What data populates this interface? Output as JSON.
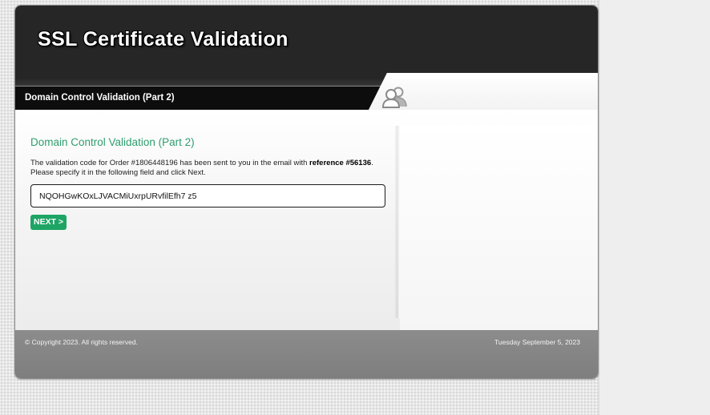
{
  "header": {
    "title": "SSL Certificate Validation"
  },
  "subbar": {
    "title": "Domain Control Validation (Part 2)"
  },
  "main": {
    "heading": "Domain Control Validation (Part 2)",
    "text_prefix": "The validation code for Order #1806448196 has been sent to you in the email with ",
    "text_bold": "reference #56136",
    "text_suffix": ".",
    "instruction": "Please specify it in the following field and click Next.",
    "code_value": "NQOHGwKOxLJVACMiUxrpURvfilEfh7 z5",
    "next_label": "NEXT >"
  },
  "footer": {
    "copyright": "© Copyright 2023. All rights reserved.",
    "date": "Tuesday September 5, 2023"
  },
  "icons": {
    "header_icon": "users-icon"
  },
  "colors": {
    "accent_green": "#2e9e6e",
    "button_green": "#1ea565",
    "header_dark": "#262626",
    "footer_gray": "#858585"
  }
}
